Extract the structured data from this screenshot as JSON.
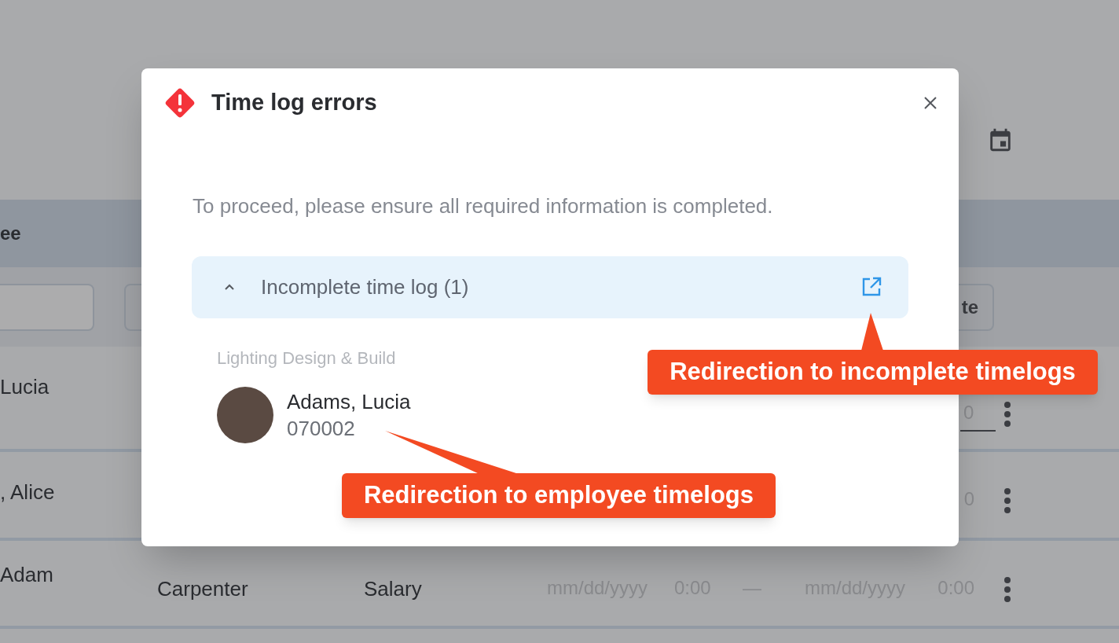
{
  "background": {
    "table_header": "ee",
    "filter_button": "te",
    "rows": [
      {
        "name": "Lucia",
        "end_time": "0",
        "end_time_field": true
      },
      {
        "name": ", Alice",
        "end_time": "0",
        "end_time_field": false
      },
      {
        "name": "Adam",
        "role": "Carpenter",
        "pay": "Salary",
        "start_date": "mm/dd/yyyy",
        "start_time": "0:00",
        "separator": "—",
        "end_date": "mm/dd/yyyy",
        "end_time": "0:00",
        "end_time_field": false
      }
    ]
  },
  "dialog": {
    "title": "Time log errors",
    "message": "To proceed, please ensure all required information is completed.",
    "sections": [
      {
        "title": "Incomplete time log (1)",
        "expanded": true,
        "groups": [
          {
            "label": "Lighting Design & Build",
            "employees": [
              {
                "name": "Adams, Lucia",
                "id": "070002"
              }
            ]
          }
        ]
      }
    ]
  },
  "callouts": [
    "Redirection to incomplete timelogs",
    "Redirection to employee timelogs"
  ]
}
